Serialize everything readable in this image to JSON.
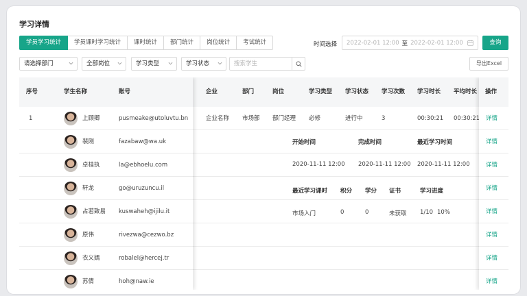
{
  "page_title": "学习详情",
  "tabs": [
    "学员学习统计",
    "学员课时学习统计",
    "课时统计",
    "部门统计",
    "岗位统计",
    "考试统计"
  ],
  "time_select": {
    "label": "时间选择",
    "start": "2022-02-01 12:00",
    "separator": "至",
    "end": "2022-02-01 12:00"
  },
  "query_label": "查询",
  "filters": {
    "department": "请选择部门",
    "position": "全部岗位",
    "study_type": "学习类型",
    "study_status": "学习状态",
    "search_placeholder": "搜索学生"
  },
  "export_label": "导出Excel",
  "columns": {
    "index": "序号",
    "name": "学生名称",
    "account": "账号",
    "company": "企业",
    "dept": "部门",
    "post": "岗位",
    "type": "学习类型",
    "status": "学习状态",
    "count": "学习次数",
    "duration": "学习时长",
    "avg": "平均时长",
    "action": "操作"
  },
  "rows": [
    {
      "index": "1",
      "name": "上顾卿",
      "account": "pusmeake@utoluvtu.bn"
    },
    {
      "index": "",
      "name": "裴刚",
      "account": "fazabaw@wa.uk"
    },
    {
      "index": "",
      "name": "卓桂执",
      "account": "la@ebhoelu.com"
    },
    {
      "index": "",
      "name": "轩龙",
      "account": "go@uruzuncu.il"
    },
    {
      "index": "",
      "name": "占若致易",
      "account": "kuswaheh@ijilu.it"
    },
    {
      "index": "",
      "name": "原伟",
      "account": "rivezwa@cezwo.bz"
    },
    {
      "index": "",
      "name": "衣义嫣",
      "account": "robalel@hercej.tr"
    },
    {
      "index": "",
      "name": "苏倩",
      "account": "hoh@naw.ie"
    }
  ],
  "first_row_detail": {
    "company": "企业名称",
    "dept": "市场部",
    "post": "部门经理",
    "type": "必修",
    "status": "进行中",
    "count": "3",
    "duration": "00:30:21",
    "avg": "00:30:21"
  },
  "action_label": "详情",
  "expanded": {
    "time_headers": [
      "开始时间",
      "完成时间",
      "最近学习时间"
    ],
    "time_values": [
      "2020-11-11 12:00",
      "2020-11-11 12:00",
      "2020-11-11 12:00"
    ],
    "progress_headers": [
      "最近学习课时",
      "积分",
      "学分",
      "证书",
      "学习进度"
    ],
    "progress_values": [
      "市场入门",
      "0",
      "0",
      "未获取",
      "1/10",
      "10%"
    ]
  }
}
